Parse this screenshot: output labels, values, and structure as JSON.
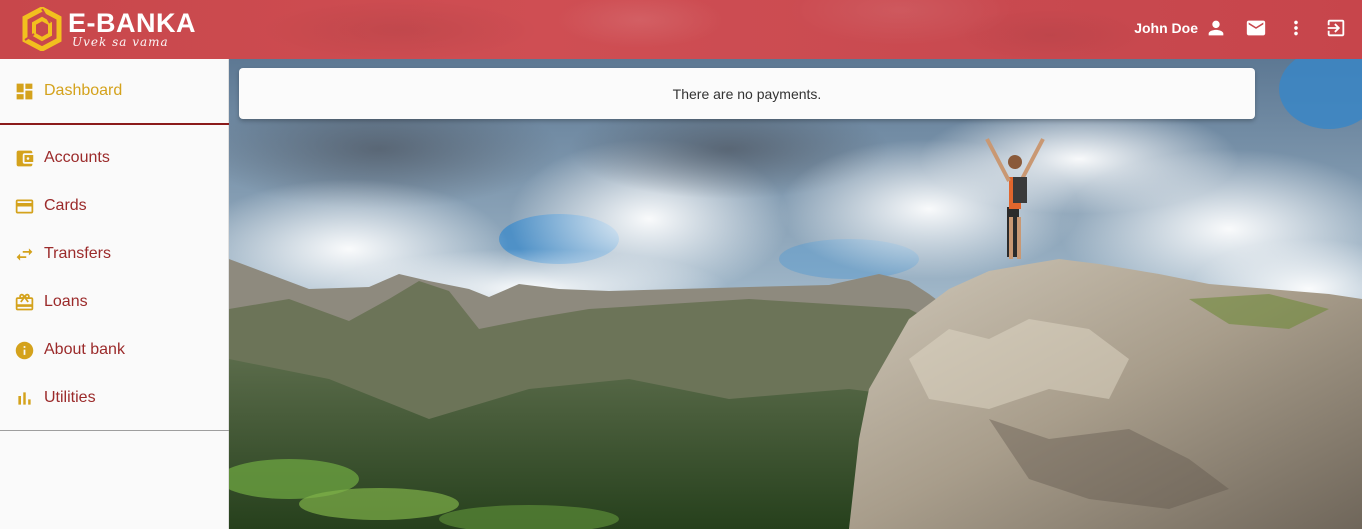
{
  "header": {
    "brand_name": "E-BANKA",
    "brand_slogan": "Uvek sa vama",
    "user_name": "John Doe",
    "brand_color": "#c94a50",
    "logo_color": "#f2c01e"
  },
  "sidebar": {
    "accent_color": "#d4a21c",
    "label_color": "#9b2a2a",
    "items": [
      {
        "label": "Dashboard",
        "icon": "dashboard-icon",
        "active": true
      },
      {
        "label": "Accounts",
        "icon": "wallet-icon"
      },
      {
        "label": "Cards",
        "icon": "credit-card-icon"
      },
      {
        "label": "Transfers",
        "icon": "swap-arrows-icon"
      },
      {
        "label": "Loans",
        "icon": "gift-card-icon"
      },
      {
        "label": "About bank",
        "icon": "info-icon"
      },
      {
        "label": "Utilities",
        "icon": "bar-chart-icon"
      }
    ]
  },
  "main": {
    "notice_text": "There are no payments."
  },
  "icons": {
    "user": "person-icon",
    "mail": "mail-icon",
    "more": "more-vert-icon",
    "logout": "logout-icon"
  }
}
